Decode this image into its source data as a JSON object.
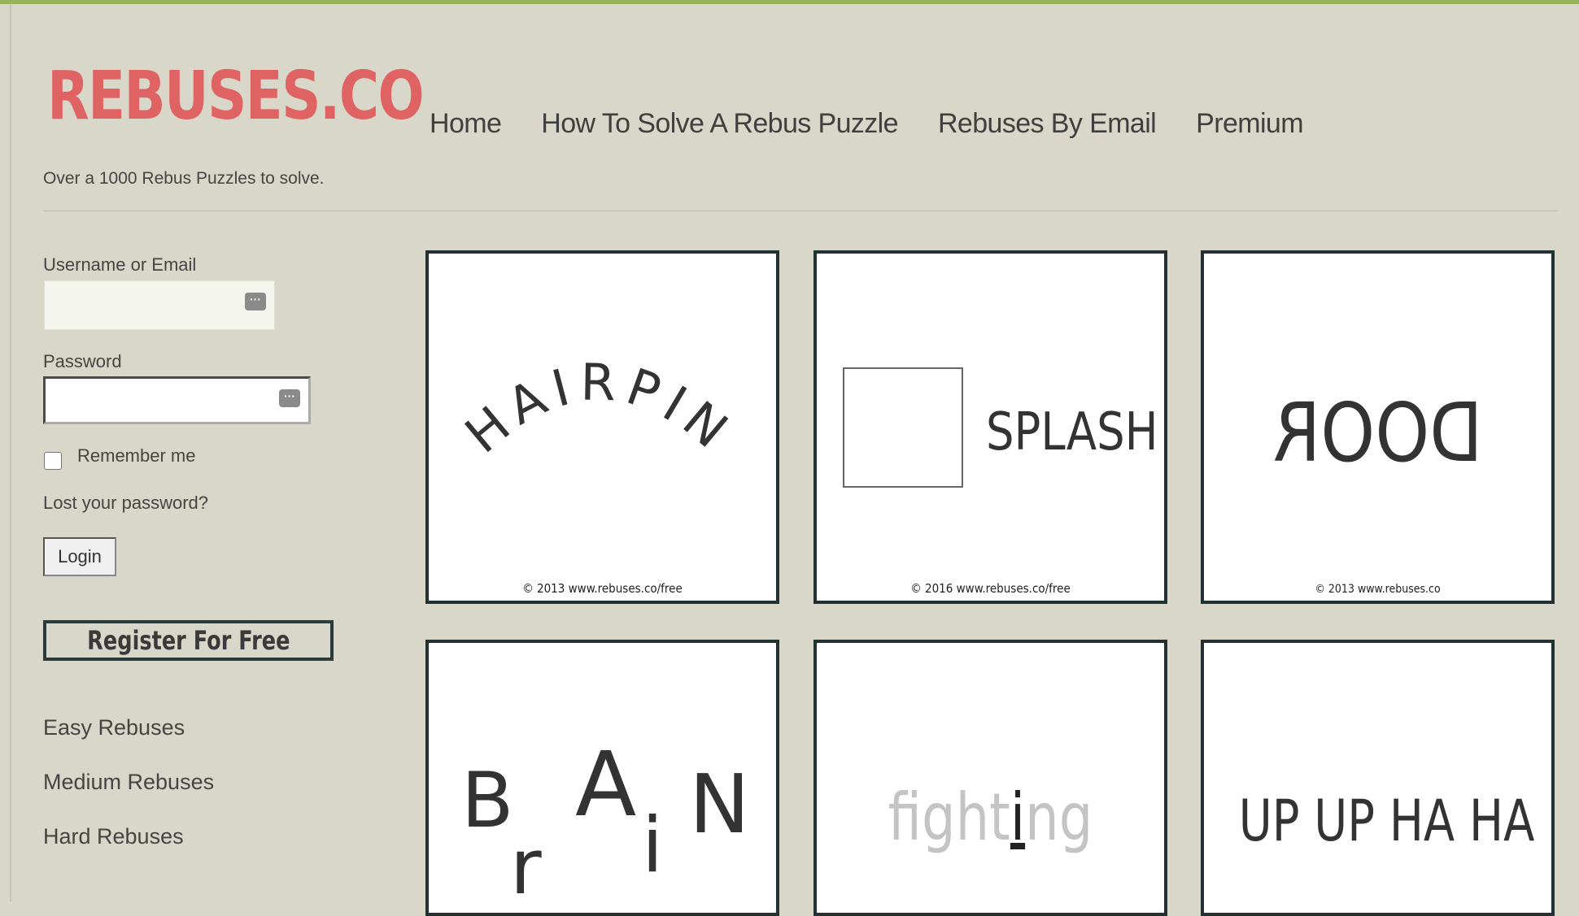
{
  "brand": {
    "logo": "REBUSES.CO",
    "tagline": "Over a 1000 Rebus Puzzles to solve."
  },
  "nav": [
    "Home",
    "How To Solve A Rebus Puzzle",
    "Rebuses By Email",
    "Premium"
  ],
  "login": {
    "username_label": "Username or Email",
    "username_value": "",
    "password_label": "Password",
    "password_value": "",
    "remember_label": "Remember me",
    "lost_password": "Lost your password?",
    "login_button": "Login",
    "register_button": "Register For Free"
  },
  "categories": [
    "Easy Rebuses",
    "Medium Rebuses",
    "Hard Rebuses"
  ],
  "puzzles": [
    {
      "text": "HAIRPIN",
      "copyright": "© 2013 www.rebuses.co/free"
    },
    {
      "text": "SPLASH",
      "copyright": "© 2016 www.rebuses.co/free"
    },
    {
      "text": "DOOR",
      "copyright": "© 2013 www.rebuses.co"
    },
    {
      "text": "BrAiN",
      "copyright": ""
    },
    {
      "text": "fighting",
      "copyright": ""
    },
    {
      "text": "UP UP HA HA",
      "copyright": ""
    }
  ],
  "colors": {
    "background": "#d8d7ca",
    "logo": "#e06363",
    "card_border": "#243133",
    "accent_line": "#9ab25a"
  },
  "icons": [
    "keyboard-icon"
  ]
}
